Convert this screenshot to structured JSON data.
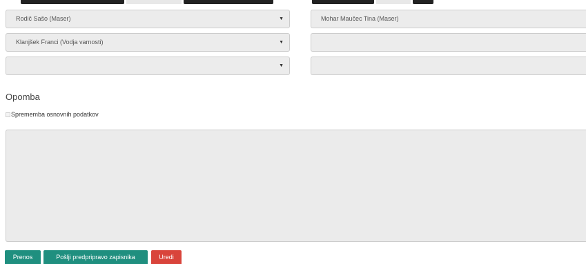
{
  "colors": {
    "primary_teal": "#1f8f7f",
    "danger_red": "#d9443b",
    "field_bg": "#ececec"
  },
  "participants": {
    "left": [
      {
        "value": "Rodič Sašo (Maser)",
        "icon": "caret-down-icon"
      },
      {
        "value": "Klanjšek Franci (Vodja varnosti)",
        "icon": "caret-down-icon"
      },
      {
        "value": "",
        "icon": "caret-down-icon"
      }
    ],
    "right": [
      {
        "value": "Mohar Maučec Tina (Maser)"
      },
      {
        "value": ""
      },
      {
        "value": ""
      }
    ]
  },
  "note_section": {
    "heading": "Opomba",
    "checkbox_label": "Sprememba osnovnih podatkov",
    "checkbox_checked": false,
    "textarea_value": ""
  },
  "actions": {
    "prenos": "Prenos",
    "poslji": "Pošlji predpripravo zapisnika",
    "uredi": "Uredi"
  }
}
